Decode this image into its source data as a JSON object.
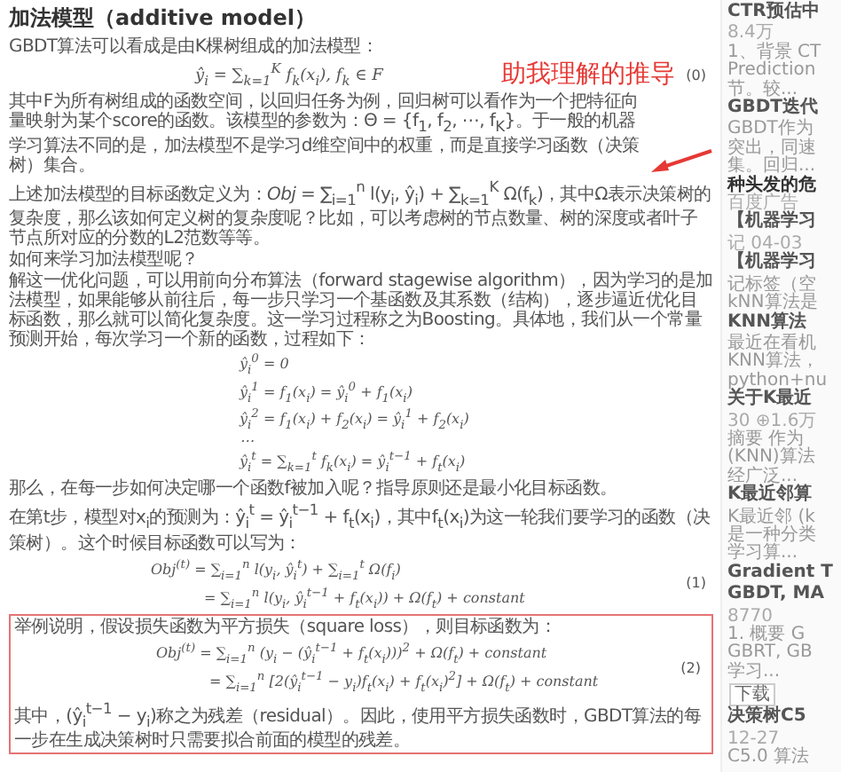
{
  "article": {
    "title": "加法模型（additive model）",
    "intro": "GBDT算法可以看成是由K棵树组成的加法模型：",
    "note": "助我理解的推导",
    "eq0": {
      "formula": "ŷ$_{i}$ = ∑$_{k=1}$$^{K}$ f$_{k}$(x$_{i}$), f$_{k}$ ∈ F",
      "number": "(0)"
    },
    "p_space": "其中F为所有树组成的函数空间，以回归任务为例，回归树可以看作为一个把特征向量映射为某个score的函数。该模型的参数为：Θ = {f$_{1}$, f$_{2}$, ⋯, f$_{K}$}。于一般的机器学习算法不同的是，加法模型不是学习d维空间中的权重，而是直接学习函数（决策树）集合。",
    "p_obj": "上述加法模型的目标函数定义为：*Obj* = ∑$_{i=1}$$^{n}$ l(y$_{i}$, ŷ$_{i}$) + ∑$_{k=1}$$^{K}$ Ω(f$_{k}$)，其中Ω表示决策树的复杂度，那么该如何定义树的复杂度呢？比如，可以考虑树的节点数量、树的深度或者叶子节点所对应的分数的L2范数等等。",
    "question": "如何来学习加法模型呢？",
    "p_boost": "解这一优化问题，可以用前向分布算法（forward stagewise algorithm），因为学习的是加法模型，如果能够从前往后，每一步只学习一个基函数及其系数（结构），逐步逼近优化目标函数，那么就可以简化复杂度。这一学习过程称之为Boosting。具体地，我们从一个常量预测开始，每次学习一个新的函数，过程如下：",
    "steps": [
      "ŷ$_{i}$$^{0}$ = 0",
      "ŷ$_{i}$$^{1}$ = f$_{1}$(x$_{i}$) = ŷ$_{i}$$^{0}$ + f$_{1}$(x$_{i}$)",
      "ŷ$_{i}$$^{2}$ = f$_{1}$(x$_{i}$) + f$_{2}$(x$_{i}$) = ŷ$_{i}$$^{1}$ + f$_{2}$(x$_{i}$)",
      "⋯",
      "ŷ$_{i}$$^{t}$ = ∑$_{k=1}$$^{t}$ f$_{k}$(x$_{i}$) = ŷ$_{i}$$^{t−1}$ + f$_{t}$(x$_{i}$)"
    ],
    "p_choose": "那么，在每一步如何决定哪一个函数f被加入呢？指导原则还是最小化目标函数。",
    "p_step": "在第t步，模型对x$_{i}$的预测为：ŷ$_{i}$$^{t}$ = ŷ$_{i}$$^{t−1}$ + f$_{t}$(x$_{i}$)，其中f$_{t}$(x$_{i}$)为这一轮我们要学习的函数（决策树）。这个时候目标函数可以写为：",
    "eq1": {
      "lines": [
        "Obj$^{(t)}$ = ∑$_{i=1}$$^{n}$ l(y$_{i}$, ŷ$_{i}$$^{t}$) + ∑$_{i=1}$$^{t}$ Ω(f$_{i}$)",
        "= ∑$_{i=1}$$^{n}$ l(y$_{i}$, ŷ$_{i}$$^{t−1}$ + f$_{t}$(x$_{i}$)) + Ω(f$_{t}$) + *constant*"
      ],
      "number": "(1)"
    },
    "p_example": "举例说明，假设损失函数为平方损失（square loss），则目标函数为：",
    "eq2": {
      "lines": [
        "Obj$^{(t)}$ = ∑$_{i=1}$$^{n}$ (y$_{i}$ − (ŷ$_{i}$$^{t−1}$ + f$_{t}$(x$_{i}$)))$^{2}$ + Ω(f$_{t}$) + *constant*",
        "= ∑$_{i=1}$$^{n}$ [2(ŷ$_{i}$$^{t−1}$ − y$_{i}$)f$_{t}$(x$_{i}$) + f$_{t}$(x$_{i}$)$^{2}$] + Ω(f$_{t}$) + *constant*"
      ],
      "number": "(2)"
    },
    "p_residual": "其中，(ŷ$_{i}$$^{t−1}$ − y$_{i}$)称之为残差（residual）。因此，使用平方损失函数时，GBDT算法的每一步在生成决策树时只需要拟合前面的模型的残差。"
  },
  "sidebar": {
    "lines": [
      {
        "text": "CTR预估中",
        "kind": "title"
      },
      {
        "text": "8.4万",
        "kind": "meta"
      },
      {
        "text": "1、背景 CT",
        "kind": "snippet"
      },
      {
        "text": "Prediction",
        "kind": "snippet"
      },
      {
        "text": "节。较...",
        "kind": "snippet"
      },
      {
        "text": "GBDT迭代",
        "kind": "title"
      },
      {
        "text": "GBDT作为",
        "kind": "snippet"
      },
      {
        "text": "突出，同速",
        "kind": "snippet"
      },
      {
        "text": "集。回归...",
        "kind": "snippet"
      },
      {
        "text": "种头发的危",
        "kind": "heading"
      },
      {
        "text": "百度广告",
        "kind": "meta"
      },
      {
        "text": "【机器学习",
        "kind": "title"
      },
      {
        "text": "记 04-03",
        "kind": "meta"
      },
      {
        "text": "【机器学习",
        "kind": "title"
      },
      {
        "text": "记标签（空",
        "kind": "snippet"
      },
      {
        "text": "kNN算法是",
        "kind": "snippet"
      },
      {
        "text": "KNN算法",
        "kind": "title"
      },
      {
        "text": "最近在看机",
        "kind": "snippet"
      },
      {
        "text": "KNN算法，",
        "kind": "snippet"
      },
      {
        "text": "python+nu",
        "kind": "snippet"
      },
      {
        "text": "关于K最近",
        "kind": "title"
      },
      {
        "text": "30 ⊕1.6万",
        "kind": "meta"
      },
      {
        "text": "摘要 作为",
        "kind": "snippet"
      },
      {
        "text": "(KNN)算法",
        "kind": "snippet"
      },
      {
        "text": "经广泛...",
        "kind": "snippet"
      },
      {
        "text": "K最近邻算",
        "kind": "title"
      },
      {
        "text": "K最近邻 (k",
        "kind": "snippet"
      },
      {
        "text": "是一种分类",
        "kind": "snippet"
      },
      {
        "text": "学习算...",
        "kind": "snippet"
      },
      {
        "text": "Gradient T",
        "kind": "title"
      },
      {
        "text": "GBDT, MA",
        "kind": "title"
      },
      {
        "text": "8770",
        "kind": "meta"
      },
      {
        "text": "1. 概要 G",
        "kind": "snippet"
      },
      {
        "text": "GBRT, GB",
        "kind": "snippet"
      },
      {
        "text": "学习...",
        "kind": "snippet"
      },
      {
        "text": "下载",
        "kind": "tag"
      },
      {
        "text": "决策树C5",
        "kind": "title"
      },
      {
        "text": "12-27",
        "kind": "meta"
      },
      {
        "text": "C5.0 算法",
        "kind": "snippet"
      }
    ]
  }
}
